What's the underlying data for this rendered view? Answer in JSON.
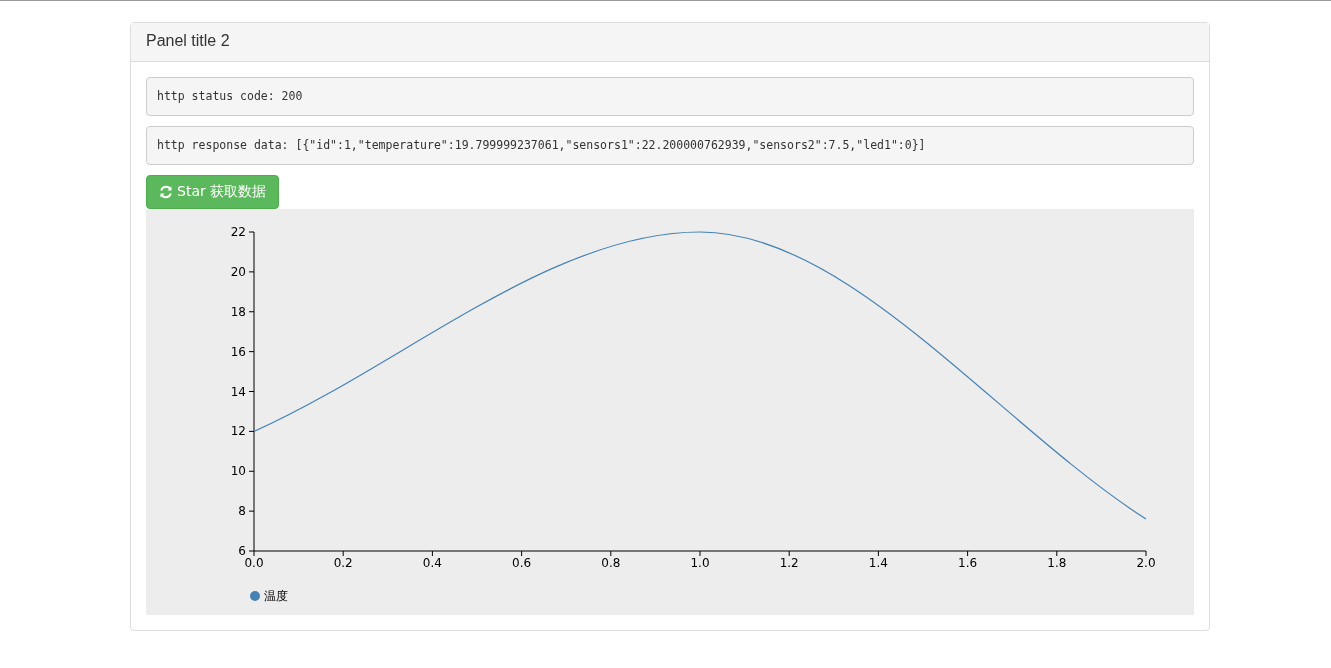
{
  "panel": {
    "title": "Panel title 2",
    "status_text": "http status code: 200",
    "response_text": "http response data: [{\"id\":1,\"temperature\":19.799999237061,\"sensors1\":22.200000762939,\"sensors2\":7.5,\"led1\":0}]",
    "button": {
      "label": "Star 获取数据"
    },
    "chart_data": {
      "type": "line",
      "x": [
        0,
        1,
        2
      ],
      "xlim": [
        0,
        2
      ],
      "ylim": [
        6,
        22
      ],
      "xticks": [
        {
          "value": 0,
          "label": "0.0"
        },
        {
          "value": 0.2,
          "label": "0.2"
        },
        {
          "value": 0.4,
          "label": "0.4"
        },
        {
          "value": 0.6,
          "label": "0.6"
        },
        {
          "value": 0.8,
          "label": "0.8"
        },
        {
          "value": 1,
          "label": "1.0"
        },
        {
          "value": 1.2,
          "label": "1.2"
        },
        {
          "value": 1.4,
          "label": "1.4"
        },
        {
          "value": 1.6,
          "label": "1.6"
        },
        {
          "value": 1.8,
          "label": "1.8"
        },
        {
          "value": 2,
          "label": "2.0"
        }
      ],
      "yticks": [
        6,
        8,
        10,
        12,
        14,
        16,
        18,
        20,
        22
      ],
      "series": [
        {
          "name": "温度",
          "color": "#4682b4",
          "values": [
            12,
            22,
            7.6
          ]
        }
      ]
    }
  }
}
